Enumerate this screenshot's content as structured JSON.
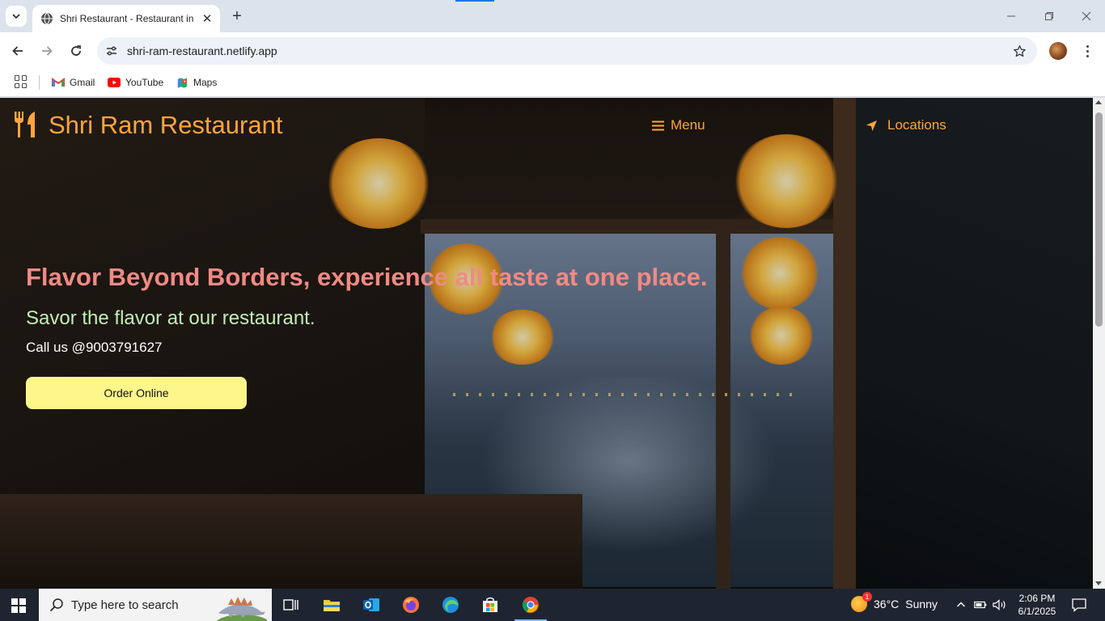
{
  "browser": {
    "tab_title": "Shri Restaurant - Restaurant in Hyderabad",
    "url": "shri-ram-restaurant.netlify.app",
    "bookmarks": [
      {
        "label": "Gmail",
        "icon": "gmail-icon"
      },
      {
        "label": "YouTube",
        "icon": "youtube-icon"
      },
      {
        "label": "Maps",
        "icon": "maps-icon"
      }
    ]
  },
  "site": {
    "brand": "Shri Ram Restaurant",
    "nav": {
      "menu_label": "Menu",
      "locations_label": "Locations"
    },
    "hero": {
      "title": "Flavor Beyond Borders, experience all taste at one place.",
      "subtitle": "Savor the flavor at our restaurant.",
      "call": "Call us @9003791627",
      "order_button": "Order Online"
    },
    "colors": {
      "brand": "#ffa53d",
      "hero_title": "#f08a84",
      "hero_subtitle": "#bff0b4",
      "order_button_bg": "#fdf68a"
    }
  },
  "taskbar": {
    "search_placeholder": "Type here to search",
    "weather_temp": "36°C",
    "weather_desc": "Sunny",
    "weather_badge": "1",
    "time": "2:06 PM",
    "date": "6/1/2025"
  }
}
